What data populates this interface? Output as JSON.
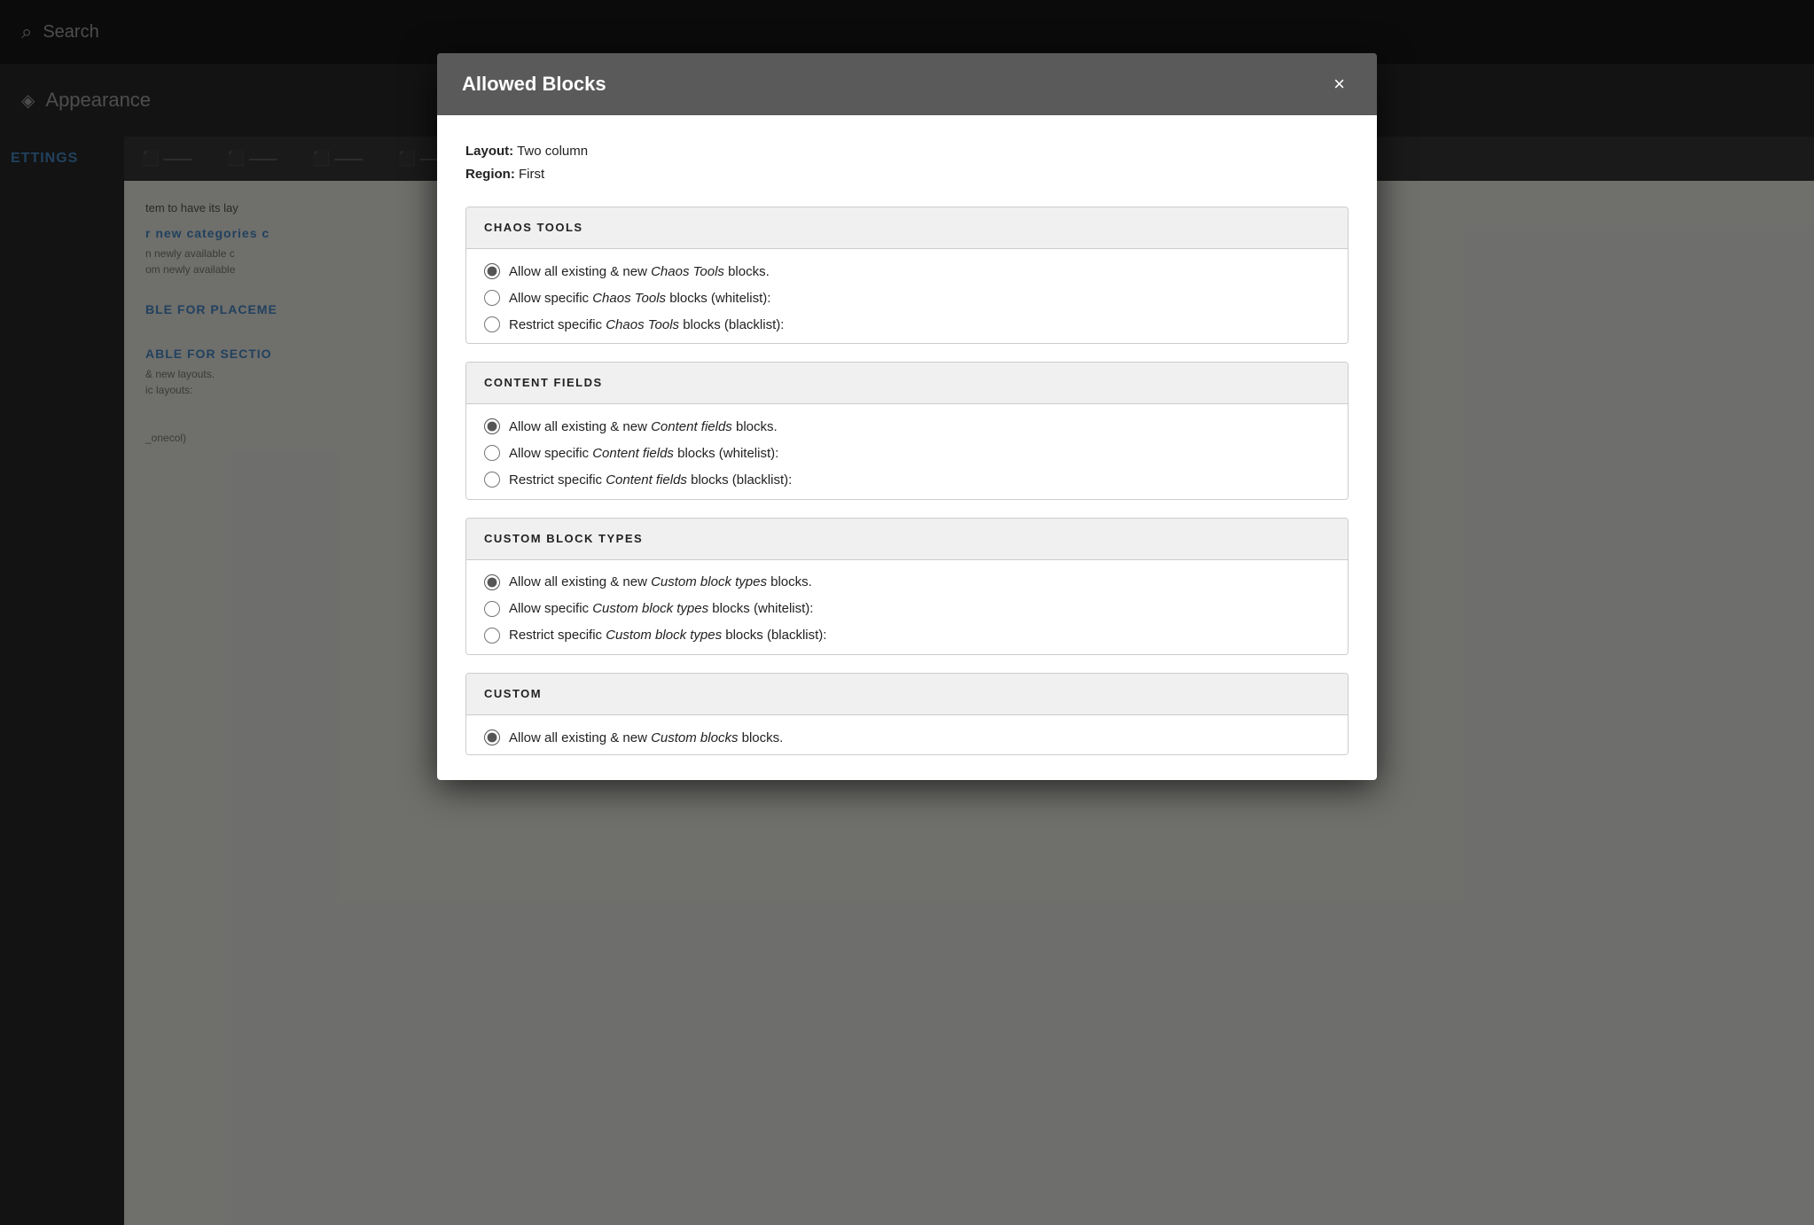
{
  "background": {
    "search_text": "Search",
    "appearance_text": "Appearance",
    "settings_label": "ETTINGS",
    "nav_tabs": [
      "",
      "",
      "",
      "",
      ""
    ],
    "main_lines": [
      "tem to have its lay",
      "new categories c",
      "n newly available c",
      "om newly available"
    ],
    "section_available_placement": "BLE FOR PLACEME",
    "section_available_section": "ABLE FOR SECTIO",
    "section_lines": [
      "& new layouts.",
      "ic layouts:"
    ],
    "bottom_text": "_onecol)"
  },
  "modal": {
    "title": "Allowed Blocks",
    "close_label": "×",
    "layout_label": "Layout:",
    "layout_value": "Two column",
    "region_label": "Region:",
    "region_value": "First",
    "sections": [
      {
        "id": "chaos-tools",
        "title": "CHAOS TOOLS",
        "options": [
          {
            "id": "ct-all",
            "checked": true,
            "label_pre": "Allow all existing & new ",
            "label_italic": "Chaos Tools",
            "label_post": " blocks."
          },
          {
            "id": "ct-specific",
            "checked": false,
            "label_pre": "Allow specific ",
            "label_italic": "Chaos Tools",
            "label_post": " blocks (whitelist):"
          },
          {
            "id": "ct-restrict",
            "checked": false,
            "label_pre": "Restrict specific ",
            "label_italic": "Chaos Tools",
            "label_post": " blocks (blacklist):"
          }
        ]
      },
      {
        "id": "content-fields",
        "title": "CONTENT FIELDS",
        "options": [
          {
            "id": "cf-all",
            "checked": true,
            "label_pre": "Allow all existing & new ",
            "label_italic": "Content fields",
            "label_post": " blocks."
          },
          {
            "id": "cf-specific",
            "checked": false,
            "label_pre": "Allow specific ",
            "label_italic": "Content fields",
            "label_post": " blocks (whitelist):"
          },
          {
            "id": "cf-restrict",
            "checked": false,
            "label_pre": "Restrict specific ",
            "label_italic": "Content fields",
            "label_post": " blocks (blacklist):"
          }
        ]
      },
      {
        "id": "custom-block-types",
        "title": "CUSTOM BLOCK TYPES",
        "options": [
          {
            "id": "cbt-all",
            "checked": true,
            "label_pre": "Allow all existing & new ",
            "label_italic": "Custom block types",
            "label_post": " blocks."
          },
          {
            "id": "cbt-specific",
            "checked": false,
            "label_pre": "Allow specific ",
            "label_italic": "Custom block types",
            "label_post": " blocks (whitelist):"
          },
          {
            "id": "cbt-restrict",
            "checked": false,
            "label_pre": "Restrict specific ",
            "label_italic": "Custom block types",
            "label_post": " blocks (blacklist):"
          }
        ]
      },
      {
        "id": "custom",
        "title": "CUSTOM",
        "options": [
          {
            "id": "c-all",
            "checked": true,
            "label_pre": "Allow all existing & new ",
            "label_italic": "Custom blocks",
            "label_post": " blocks."
          }
        ],
        "partial": true
      }
    ]
  }
}
